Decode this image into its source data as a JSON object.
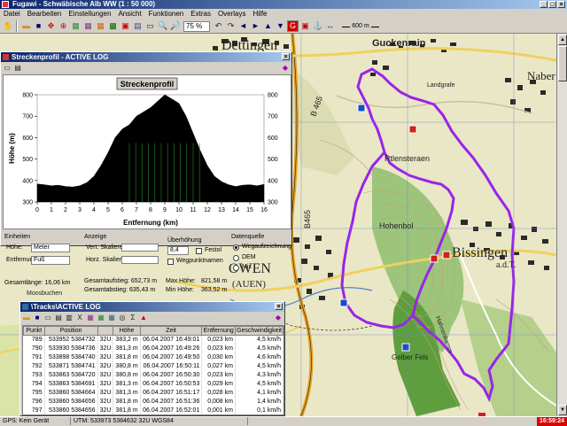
{
  "window": {
    "title": "Fugawi - Schwäbische Alb WW (1 : 50 000)",
    "buttons": [
      "_",
      "□",
      "×"
    ]
  },
  "menu": [
    "Datei",
    "Bearbeiten",
    "Einstellungen",
    "Ansicht",
    "Funktionen",
    "Extras",
    "Overlays",
    "Hilfe"
  ],
  "toolbar": {
    "zoom": "75 %",
    "scale": "600 m"
  },
  "map": {
    "labels": {
      "dettingen": "Dettingen",
      "guckenrain": "Guckenrain",
      "naberh": "Naber",
      "bissingen": "Bissingen",
      "bissingen_sub": "a.d.T.",
      "owen": "OWEN",
      "owen_sub": "(AUEN)",
      "b465a": "B 465",
      "b465b": "B465",
      "rottenstetten": "Rtlensteraen",
      "hohenbol": "Hohenbol",
      "gelber_fels": "Gelber Fels",
      "moosbusch": "Moosbuchen",
      "landgraf": "Landgrafe",
      "hahnenkamm": "Hahnenkamm"
    }
  },
  "profile": {
    "title": "Streckenprofil - ACTIVE LOG",
    "chart_data": {
      "type": "area",
      "title": "Streckenprofil",
      "xlabel": "Entfernung (km)",
      "ylabel": "Höhe (m)",
      "xlim": [
        0,
        16
      ],
      "ylim": [
        300,
        800
      ],
      "x_ticks": [
        "0",
        "1",
        "2",
        "3",
        "4",
        "5",
        "6",
        "7",
        "8",
        "9",
        "10",
        "11",
        "12",
        "13",
        "14",
        "15",
        "16"
      ],
      "y_ticks": [
        "300",
        "400",
        "500",
        "600",
        "700",
        "800"
      ],
      "x": [
        0,
        0.5,
        1,
        1.5,
        2,
        2.5,
        3,
        3.5,
        4,
        4.5,
        5,
        5.5,
        6,
        6.5,
        7,
        7.5,
        8,
        8.5,
        9,
        9.5,
        10,
        10.5,
        11,
        11.5,
        12,
        12.5,
        13,
        13.5,
        14,
        14.5,
        15,
        15.5,
        16
      ],
      "y": [
        384,
        380,
        375,
        378,
        372,
        370,
        375,
        390,
        420,
        470,
        530,
        600,
        640,
        660,
        700,
        720,
        740,
        770,
        800,
        780,
        760,
        700,
        620,
        540,
        470,
        420,
        395,
        380,
        372,
        378,
        380,
        375,
        382
      ]
    },
    "fields": {
      "einheiten": "Einheiten",
      "hoehe_label": "Höhe:",
      "hoehe_value": "Meter",
      "entfernung_label": "Entfernung:",
      "entfernung_value": "Fuß",
      "anzeige": "Anzeige",
      "vert_label": "Vert. Skalieren:",
      "horz_label": "Horz. Skalieren:",
      "ueberhoehung": "Überhöhung",
      "ueberhoehung_value": "8,4",
      "festol": "Festol",
      "wegpunktnamen": "Wegpunktnamen",
      "datenquelle": "Datenquelle",
      "wegaufzeichnung": "Wegaufzeichnung",
      "dem": "DEM",
      "mix": "Mix",
      "gesamtlaenge": "Gesamtlänge: 16,06 km",
      "gesamtaufstieg": "Gesamtaufstieg: 652,73 m",
      "gesamtabstieg": "Gesamtabstieg: 635,43 m",
      "max_hoehe": "Max Höhe:",
      "max_hoehe_value": "821,58 m",
      "min_hoehe": "Min Höhe:",
      "min_hoehe_value": "363,52 m"
    }
  },
  "tracks": {
    "title": "\\Tracks\\ACTIVE LOG",
    "columns": [
      "Punkt",
      "Position",
      "",
      "Höhe",
      "Zeit",
      "Entfernung",
      "Geschwindigkeit"
    ],
    "rows": [
      [
        "789",
        "533952 5384732",
        "32U",
        "383,2 m",
        "06.04.2007 16:49:01",
        "0,023 km",
        "4,5 km/h"
      ],
      [
        "790",
        "533930 5384736",
        "32U",
        "381,3 m",
        "06.04.2007 16:49:26",
        "0,023 km",
        "4,5 km/h"
      ],
      [
        "791",
        "533898 5384740",
        "32U",
        "381,8 m",
        "06.04.2007 16:49:50",
        "0,030 km",
        "4,6 km/h"
      ],
      [
        "792",
        "533871 5384741",
        "32U",
        "380,8 m",
        "06.04.2007 16:50:11",
        "0,027 km",
        "4,5 km/h"
      ],
      [
        "793",
        "533863 5384720",
        "32U",
        "380,8 m",
        "06.04.2007 16:50:30",
        "0,023 km",
        "4,3 km/h"
      ],
      [
        "794",
        "533863 5384691",
        "32U",
        "381,3 m",
        "06.04.2007 16:50:53",
        "0,029 km",
        "4,5 km/h"
      ],
      [
        "795",
        "533860 5384664",
        "32U",
        "381,3 m",
        "06.04.2007 16:51:17",
        "0,028 km",
        "4,1 km/h"
      ],
      [
        "796",
        "533860 5384656",
        "32U",
        "381,8 m",
        "06.04.2007 16:51:36",
        "0,008 km",
        "1,4 km/h"
      ],
      [
        "797",
        "533860 5384656",
        "32U",
        "381,8 m",
        "06.04.2007 16:52:01",
        "0,001 km",
        "0,1 km/h"
      ],
      [
        "798",
        "533860 5384652",
        "32U",
        "381,8 m",
        "06.04.2007 16:52:13",
        "0,004 km",
        "1,2 km/h"
      ]
    ]
  },
  "status": {
    "gps": "GPS: Kein Gerät",
    "coords": "UTM: 533973  5384632  32U  WGS84",
    "time": "16:59:24"
  },
  "colors": {
    "track": "#9a24e8",
    "profile_fill": "#000000",
    "title_bar": "#0a246a"
  }
}
